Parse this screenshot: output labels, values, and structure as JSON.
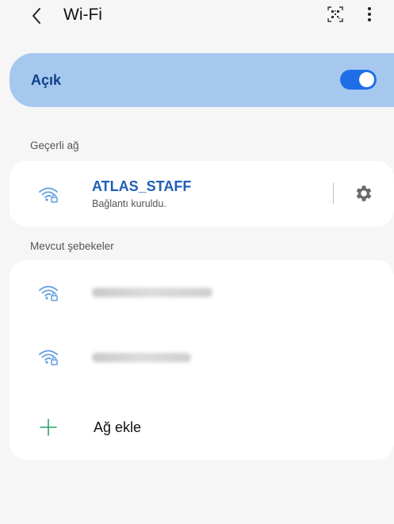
{
  "header": {
    "title": "Wi-Fi",
    "back_icon": "chevron-left-icon",
    "qr_icon": "qr-scan-icon",
    "more_icon": "more-vertical-icon"
  },
  "wifi_toggle": {
    "label": "Açık",
    "state": "on",
    "accent_color": "#1f6ee8",
    "card_color": "#a6c8ef"
  },
  "current_network": {
    "section_label": "Geçerli ağ",
    "name": "ATLAS_STAFF",
    "status": "Bağlantı kuruldu.",
    "icon": "wifi-lock-icon",
    "settings_icon": "gear-icon"
  },
  "available_networks": {
    "section_label": "Mevcut şebekeler",
    "items": [
      {
        "name": "",
        "blurred": true,
        "icon": "wifi-lock-icon"
      },
      {
        "name": "",
        "blurred": true,
        "icon": "wifi-lock-icon"
      }
    ],
    "add_network_label": "Ağ ekle",
    "add_icon": "plus-icon",
    "add_icon_color": "#2f9f6a"
  }
}
